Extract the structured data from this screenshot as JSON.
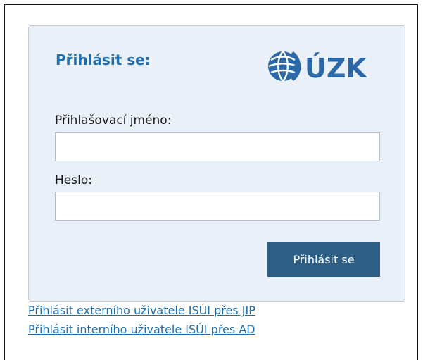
{
  "login": {
    "title": "Přihlásit se:",
    "logo_text": "ÚZK",
    "username_label": "Přihlašovací jméno:",
    "username_value": "",
    "password_label": "Heslo:",
    "password_value": "",
    "submit_label": "Přihlásit se"
  },
  "links": {
    "external_jip": "Přihlásit externího uživatele ISÚI přes JIP",
    "internal_ad": "Přihlásit interního uživatele ISÚI přes AD"
  },
  "colors": {
    "brand_blue": "#1f6fb0",
    "button": "#2d5f86",
    "panel_bg": "#eaf0f7"
  },
  "icons": {
    "logo": "cuzk-globe-logo"
  }
}
